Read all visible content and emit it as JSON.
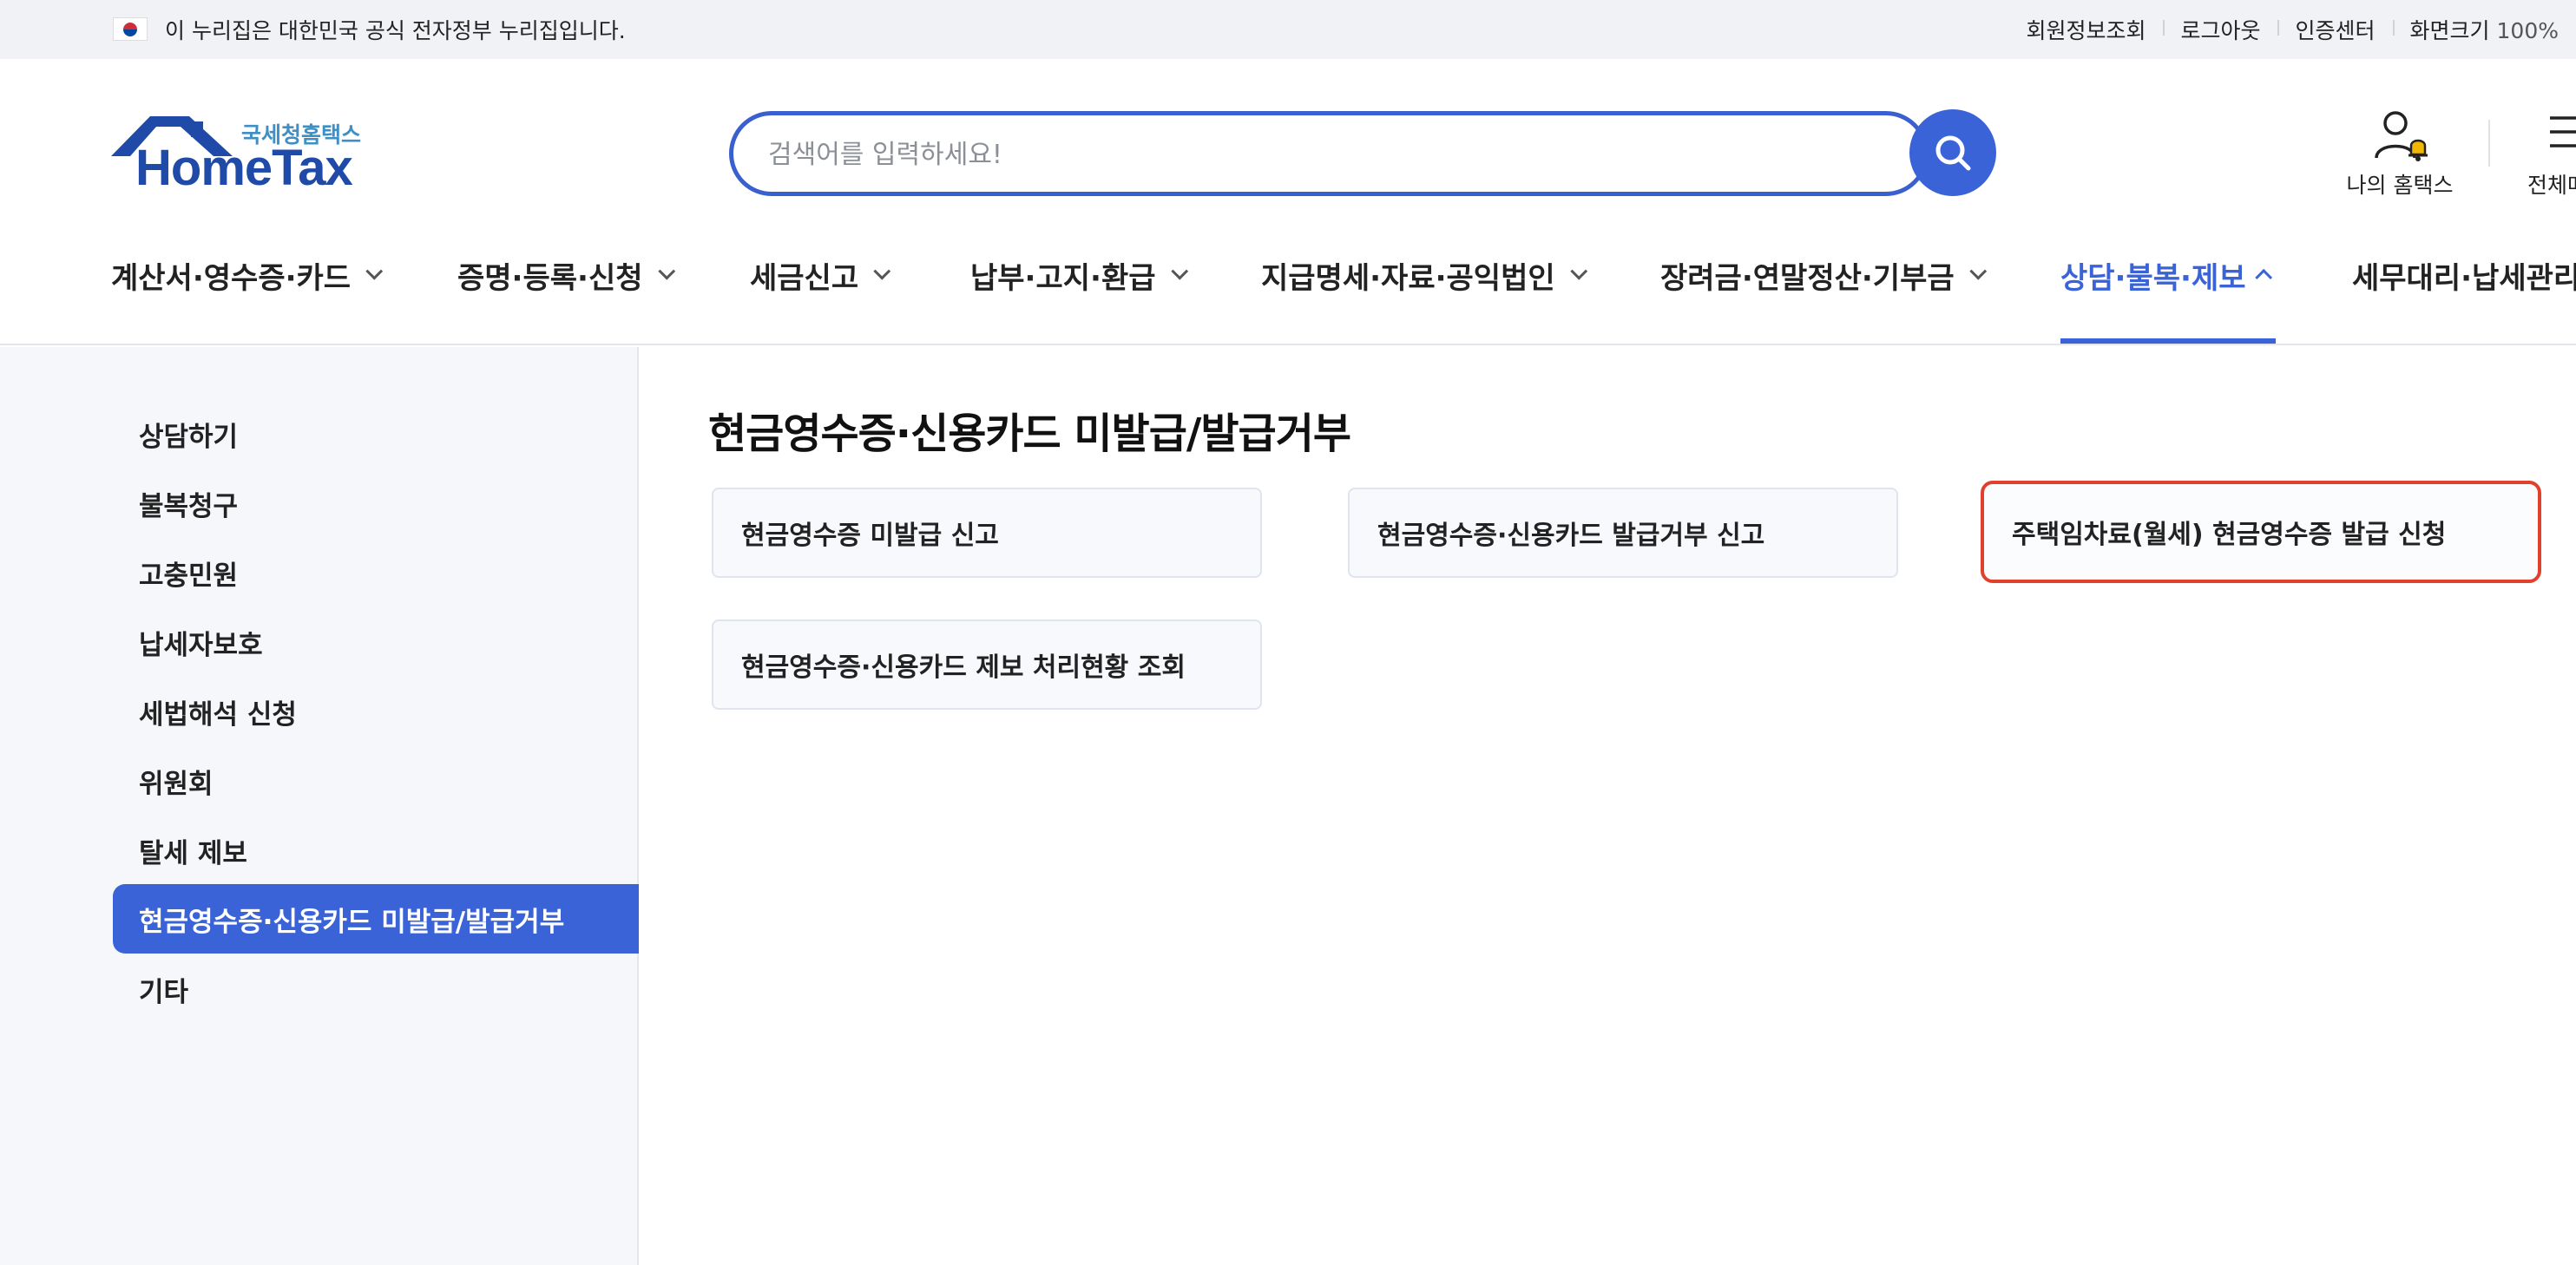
{
  "gov_banner": {
    "text": "이 누리집은 대한민국 공식 전자정부 누리집입니다.",
    "links": [
      "회원정보조회",
      "로그아웃",
      "인증센터",
      "화면크기"
    ],
    "zoom_value": "100%"
  },
  "header": {
    "logo_sub": "국세청홈택스",
    "logo_main": "HomeTax",
    "search_placeholder": "검색어를 입력하세요!",
    "my_hometax_label": "나의 홈택스",
    "all_menu_label": "전체메뉴"
  },
  "gnb": {
    "items": [
      {
        "label": "계산서·영수증·카드"
      },
      {
        "label": "증명·등록·신청"
      },
      {
        "label": "세금신고"
      },
      {
        "label": "납부·고지·환급"
      },
      {
        "label": "지급명세·자료·공익법인"
      },
      {
        "label": "장려금·연말정산·기부금"
      },
      {
        "label": "상담·불복·제보"
      },
      {
        "label": "세무대리·납세관리"
      }
    ],
    "active_index": 6
  },
  "sidebar": {
    "items": [
      {
        "label": "상담하기"
      },
      {
        "label": "불복청구"
      },
      {
        "label": "고충민원"
      },
      {
        "label": "납세자보호"
      },
      {
        "label": "세법해석 신청"
      },
      {
        "label": "위원회"
      },
      {
        "label": "탈세 제보"
      },
      {
        "label": "현금영수증·신용카드 미발급/발급거부"
      },
      {
        "label": "기타"
      }
    ],
    "active_index": 7
  },
  "content": {
    "title": "현금영수증·신용카드 미발급/발급거부",
    "cards": [
      {
        "label": "현금영수증 미발급 신고"
      },
      {
        "label": "현금영수증·신용카드 발급거부 신고"
      },
      {
        "label": "주택임차료(월세) 현금영수증 발급 신청"
      },
      {
        "label": "현금영수증·신용카드 제보 처리현황 조회"
      }
    ],
    "highlighted_index": 2
  },
  "colors": {
    "accent": "#3a63d8",
    "highlight_border": "#e0402c",
    "sidebar_bg": "#f5f7fb"
  }
}
